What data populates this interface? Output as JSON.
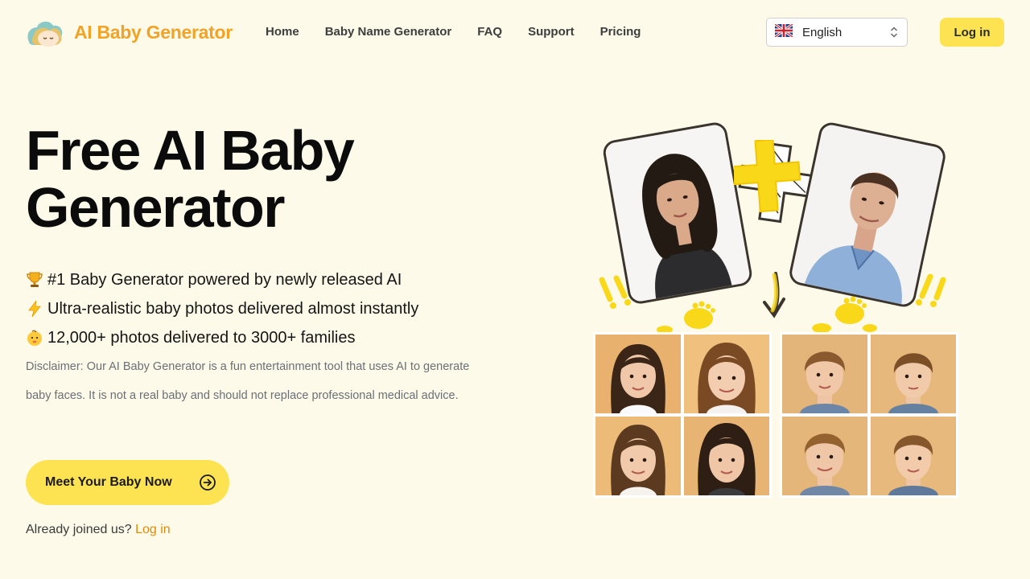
{
  "brand": {
    "name": "AI Baby Generator"
  },
  "nav": {
    "links": [
      "Home",
      "Baby Name Generator",
      "FAQ",
      "Support",
      "Pricing"
    ],
    "language": "English",
    "login_label": "Log in"
  },
  "hero": {
    "title": "Free AI Baby Generator",
    "features": [
      {
        "icon": "trophy-icon",
        "text": "#1 Baby Generator powered by newly released AI"
      },
      {
        "icon": "lightning-icon",
        "text": "Ultra-realistic baby photos delivered almost instantly"
      },
      {
        "icon": "baby-icon",
        "text": "12,000+ photos delivered to 3000+ families"
      }
    ],
    "disclaimer": "Disclaimer: Our AI Baby Generator is a fun entertainment tool that uses AI to generate baby faces. It is not a real baby and should not replace professional medical advice.",
    "cta_label": "Meet Your Baby Now",
    "joined_text": "Already joined us?",
    "joined_link": "Log in"
  },
  "colors": {
    "accent": "#fde352",
    "brand": "#f0a326",
    "background": "#fefae9",
    "link": "#e08a0c"
  }
}
